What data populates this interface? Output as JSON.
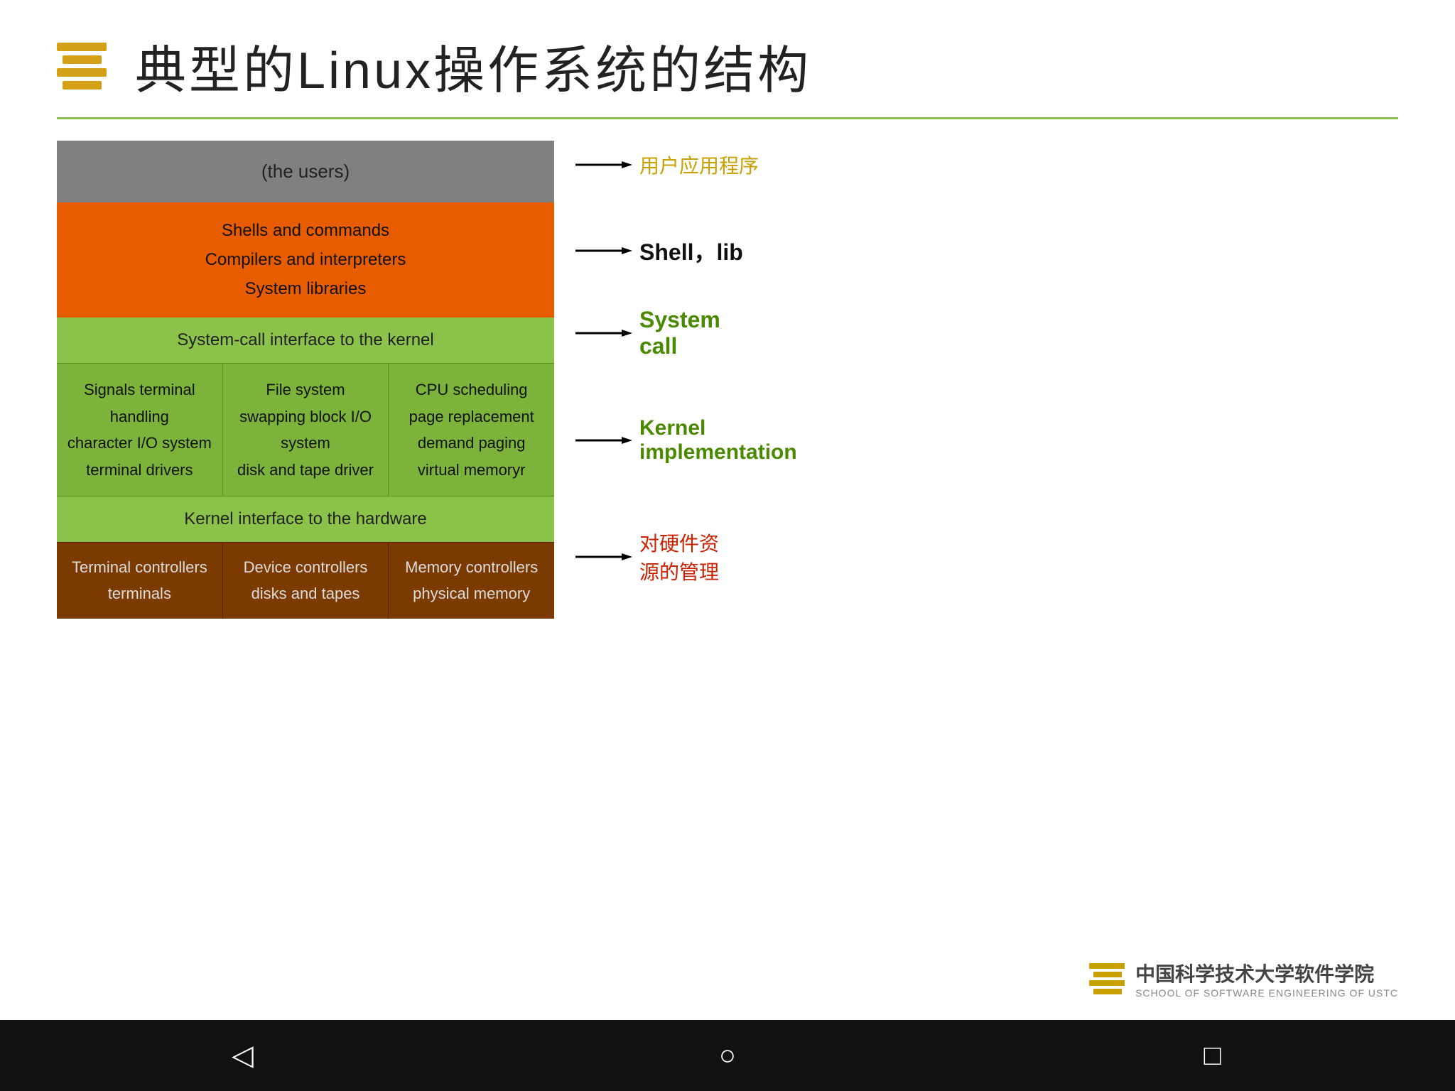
{
  "title": "典型的Linux操作系统的结构",
  "diagram": {
    "layer_users": "(the users)",
    "layer_orange": {
      "line1": "Shells and commands",
      "line2": "Compilers and interpreters",
      "line3": "System libraries"
    },
    "layer_syscall": "System-call interface to the kernel",
    "kernel_col1": {
      "line1": "Signals terminal",
      "line2": "handling",
      "line3": "character I/O system",
      "line4": "terminal    drivers"
    },
    "kernel_col2": {
      "line1": "File system",
      "line2": "swapping block I/O",
      "line3": "system",
      "line4": "disk and tape driver"
    },
    "kernel_col3": {
      "line1": "CPU scheduling",
      "line2": "page replacement",
      "line3": "demand paging",
      "line4": "virtual memoryr"
    },
    "hw_interface": "Kernel interface to the hardware",
    "hw_col1": {
      "line1": "Terminal controllers",
      "line2": "terminals"
    },
    "hw_col2": {
      "line1": "Device controllers",
      "line2": "disks and tapes"
    },
    "hw_col3": {
      "line1": "Memory controllers",
      "line2": "physical memory"
    }
  },
  "annotations": {
    "ann1": "用户应用程序",
    "ann2_line1": "Shell，lib",
    "ann3_line1": "System",
    "ann3_line2": "call",
    "ann4_line1": "Kernel",
    "ann4_line2": "implementation",
    "ann5_line1": "对硬件资",
    "ann5_line2": "源的管理"
  },
  "bottom_logo": {
    "cn": "中国科学技术大学软件学院",
    "en": "SCHOOL OF SOFTWARE ENGINEERING OF USTC"
  },
  "navbar": {
    "back": "◁",
    "home": "○",
    "recent": "□"
  }
}
